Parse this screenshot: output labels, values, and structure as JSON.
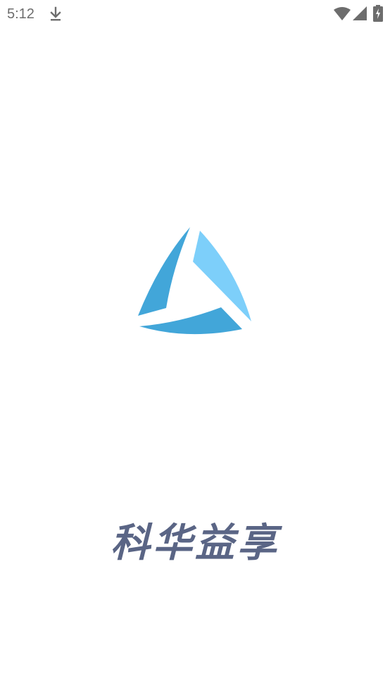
{
  "status_bar": {
    "time": "5:12",
    "icons": [
      "download-icon",
      "wifi-icon",
      "cell-signal-icon",
      "battery-charging-icon"
    ],
    "icon_color": "#6d6d6d"
  },
  "splash": {
    "app_name": "科华益享",
    "app_name_color": "#5a6585",
    "logo": {
      "name": "triangle-logo",
      "colors": [
        "#42a6d9",
        "#7dcffa"
      ]
    }
  }
}
